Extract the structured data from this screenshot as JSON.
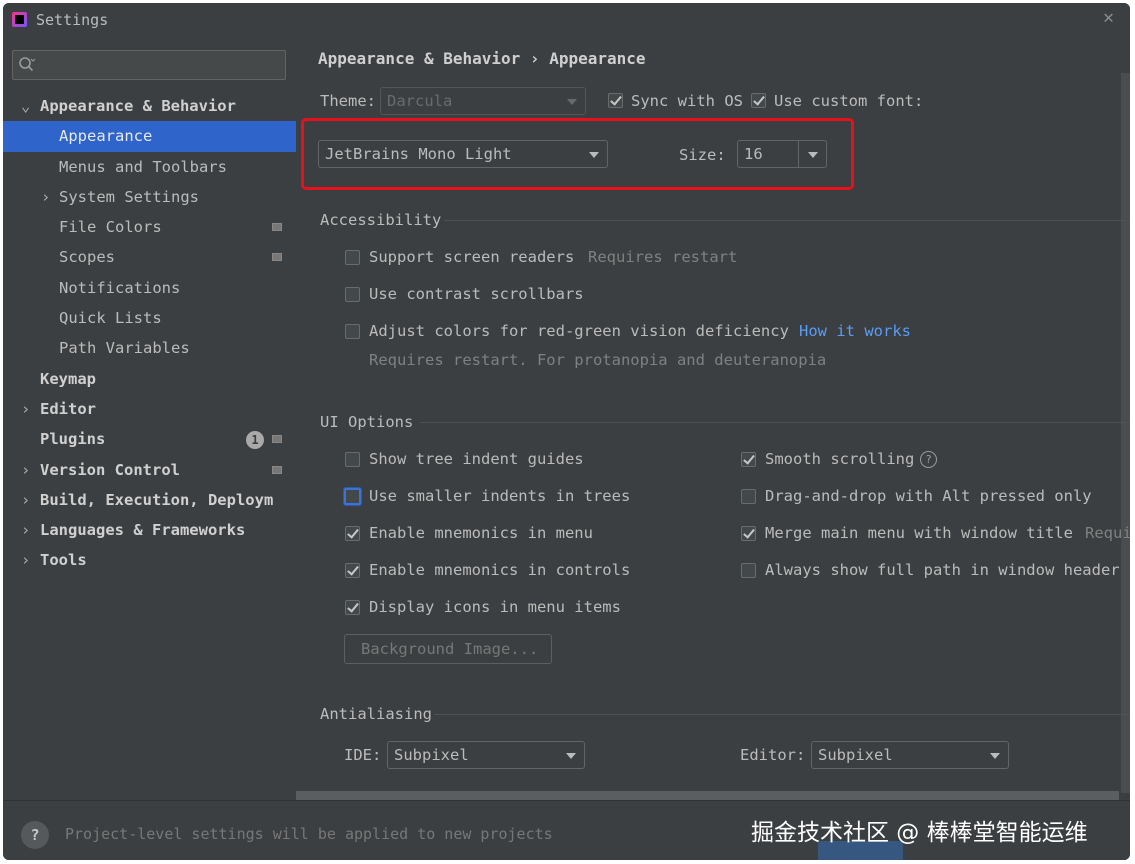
{
  "window": {
    "title": "Settings"
  },
  "sidebar": {
    "search_placeholder": "",
    "items": [
      {
        "label": "Appearance & Behavior",
        "chevron": "⌄"
      },
      {
        "label": "Appearance"
      },
      {
        "label": "Menus and Toolbars"
      },
      {
        "label": "System Settings",
        "chevron": "›"
      },
      {
        "label": "File Colors"
      },
      {
        "label": "Scopes"
      },
      {
        "label": "Notifications"
      },
      {
        "label": "Quick Lists"
      },
      {
        "label": "Path Variables"
      },
      {
        "label": "Keymap"
      },
      {
        "label": "Editor",
        "chevron": "›"
      },
      {
        "label": "Plugins",
        "badge": "1"
      },
      {
        "label": "Version Control",
        "chevron": "›"
      },
      {
        "label": "Build, Execution, Deploym",
        "chevron": "›"
      },
      {
        "label": "Languages & Frameworks",
        "chevron": "›"
      },
      {
        "label": "Tools",
        "chevron": "›"
      }
    ]
  },
  "content": {
    "breadcrumb": "Appearance & Behavior › Appearance",
    "theme_label": "Theme:",
    "theme_value": "Darcula",
    "sync_os_label": "Sync with OS",
    "custom_font_label": "Use custom font:",
    "font_value": "JetBrains Mono Light",
    "size_label": "Size:",
    "size_value": "16",
    "accessibility": {
      "title": "Accessibility",
      "screen_readers": "Support screen readers",
      "screen_readers_note": "Requires restart",
      "contrast_scrollbars": "Use contrast scrollbars",
      "adjust_colors": "Adjust colors for red-green vision deficiency",
      "how_it_works": "How it works",
      "adjust_note": "Requires restart. For protanopia and deuteranopia"
    },
    "ui_options": {
      "title": "UI Options",
      "tree_indent": "Show tree indent guides",
      "smaller_indents": "Use smaller indents in trees",
      "mnemonics_menu": "Enable mnemonics in menu",
      "mnemonics_controls": "Enable mnemonics in controls",
      "display_icons": "Display icons in menu items",
      "smooth_scrolling": "Smooth scrolling",
      "help_symbol": "?",
      "drag_drop": "Drag-and-drop with Alt pressed only",
      "merge_menu": "Merge main menu with window title",
      "merge_note": "Requi",
      "full_path": "Always show full path in window header",
      "background_image": "Background Image..."
    },
    "antialiasing": {
      "title": "Antialiasing",
      "ide_label": "IDE:",
      "ide_value": "Subpixel",
      "editor_label": "Editor:",
      "editor_value": "Subpixel"
    }
  },
  "footer": {
    "help": "?",
    "text": "Project-level settings will be applied to new projects",
    "watermark": "掘金技术社区 @ 棒棒堂智能运维"
  }
}
